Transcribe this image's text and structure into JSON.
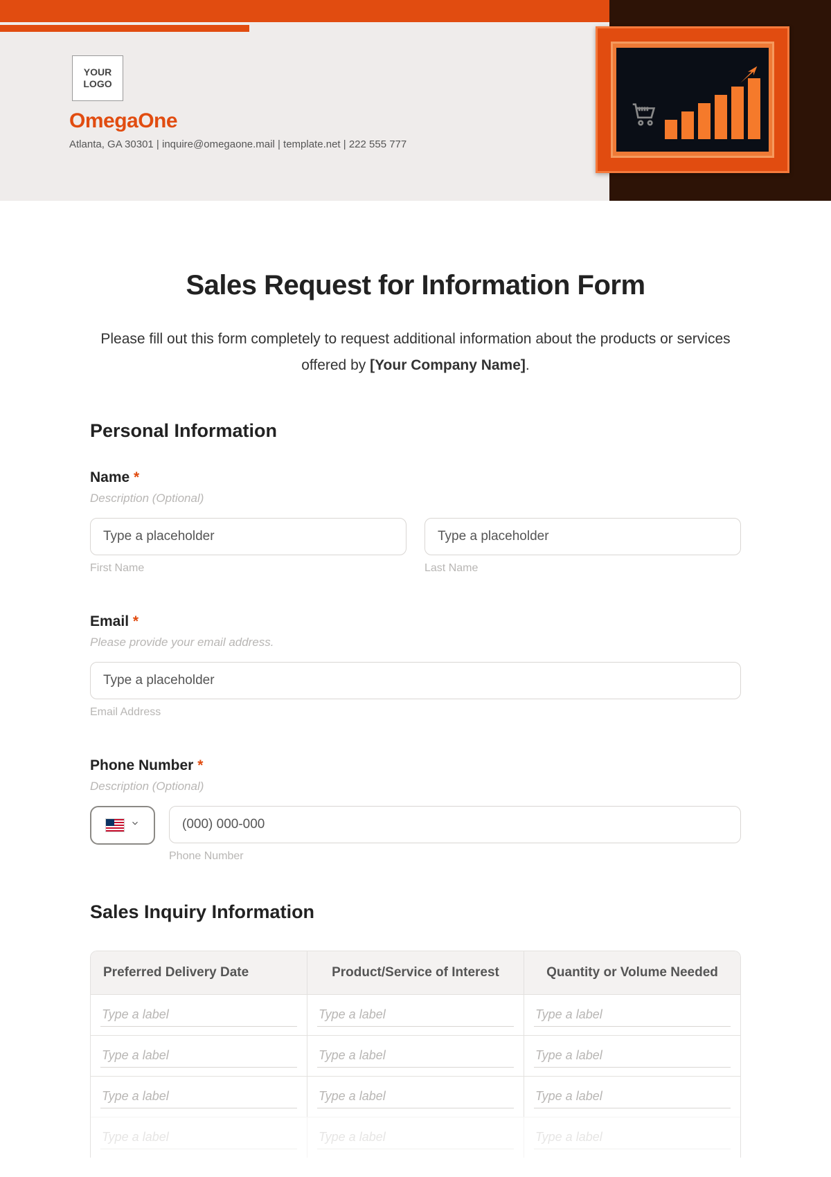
{
  "header": {
    "logo_text": "YOUR LOGO",
    "company_name": "OmegaOne",
    "company_info": "Atlanta, GA 30301 | inquire@omegaone.mail | template.net | 222 555 777"
  },
  "page": {
    "title": "Sales Request for Information Form",
    "intro_pre": "Please fill out this form completely to request additional information about the products or services offered by ",
    "intro_bold": "[Your Company Name]",
    "intro_post": "."
  },
  "sections": {
    "personal": "Personal Information",
    "inquiry": "Sales Inquiry Information"
  },
  "fields": {
    "name": {
      "label": "Name",
      "required": "*",
      "desc": "Description (Optional)",
      "first_placeholder": "Type a placeholder",
      "first_sub": "First Name",
      "last_placeholder": "Type a placeholder",
      "last_sub": "Last Name"
    },
    "email": {
      "label": "Email",
      "required": "*",
      "desc": "Please provide your email address.",
      "placeholder": "Type a placeholder",
      "sub": "Email Address"
    },
    "phone": {
      "label": "Phone Number",
      "required": "*",
      "desc": "Description (Optional)",
      "placeholder": "(000) 000-000",
      "sub": "Phone Number"
    }
  },
  "table": {
    "headers": [
      "Preferred Delivery Date",
      "Product/Service of Interest",
      "Quantity or Volume Needed"
    ],
    "cell_placeholder": "Type a label",
    "row_count": 4
  }
}
